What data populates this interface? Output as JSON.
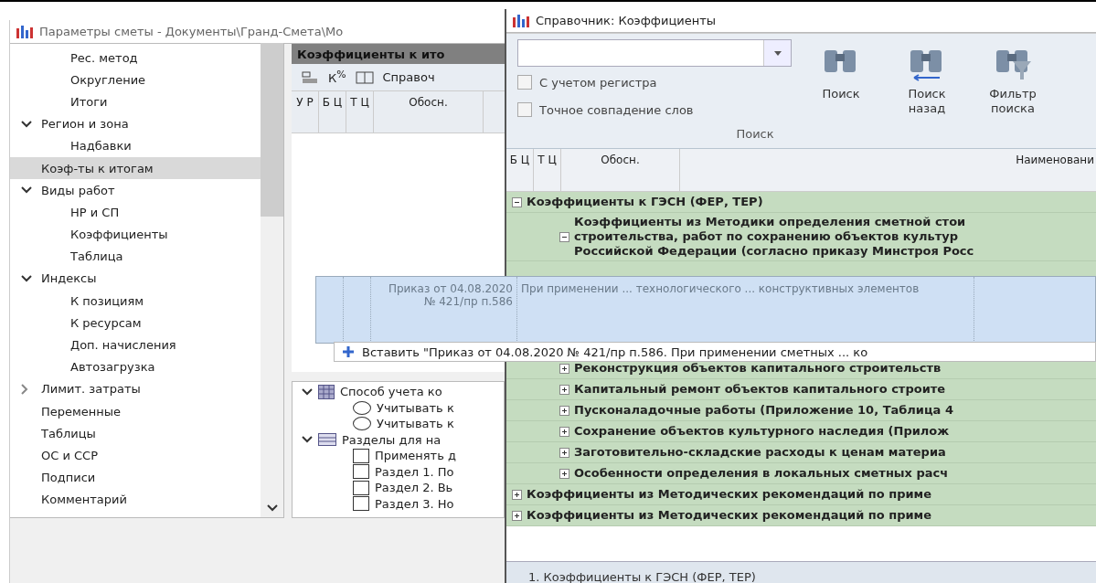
{
  "main_window": {
    "title": "Параметры сметы - Документы\\Гранд-Смета\\Мо",
    "nav": [
      {
        "children": [
          {
            "label": "Рес. метод",
            "selected": false
          },
          {
            "label": "Округление",
            "selected": false
          },
          {
            "label": "Итоги",
            "selected": false
          }
        ]
      },
      {
        "label": "Регион и зона",
        "selected": false,
        "expanded": true,
        "children": [
          {
            "label": "Надбавки",
            "selected": false
          }
        ]
      },
      {
        "label": "Коэф-ты к итогам",
        "selected": true
      },
      {
        "label": "Виды работ",
        "selected": false,
        "expanded": true,
        "children": [
          {
            "label": "НР и СП",
            "selected": false
          },
          {
            "label": "Коэффициенты",
            "selected": false
          },
          {
            "label": "Таблица",
            "selected": false
          }
        ]
      },
      {
        "label": "Индексы",
        "selected": false,
        "expanded": true,
        "children": [
          {
            "label": "К позициям",
            "selected": false
          },
          {
            "label": "К ресурсам",
            "selected": false
          },
          {
            "label": "Доп. начисления",
            "selected": false
          },
          {
            "label": "Автозагрузка",
            "selected": false
          }
        ]
      },
      {
        "label": "Лимит. затраты",
        "selected": false,
        "expanded": false
      },
      {
        "label": "Переменные",
        "selected": false
      },
      {
        "label": "Таблицы",
        "selected": false
      },
      {
        "label": "ОС и ССР",
        "selected": false
      },
      {
        "label": "Подписи",
        "selected": false
      },
      {
        "label": "Комментарий",
        "selected": false
      }
    ],
    "panel": {
      "header": "Коэффициенты к ито",
      "toolbar_label": "Справоч",
      "toolbar_k": "К",
      "toolbar_percent": "%",
      "columns": [
        "У Р",
        "Б Ц",
        "Т Ц",
        "Обосн."
      ],
      "options": [
        {
          "label": "Способ учета ко",
          "kind": "table-group",
          "expanded": true,
          "children": [
            {
              "label": "Учитывать к",
              "kind": "radio",
              "selected": false
            },
            {
              "label": "Учитывать к",
              "kind": "radio",
              "selected": false
            }
          ]
        },
        {
          "label": "Разделы для на",
          "kind": "list-group",
          "expanded": true,
          "children": [
            {
              "label": "Применять д",
              "kind": "checkbox",
              "checked": false
            },
            {
              "label": "Раздел 1. По",
              "kind": "checkbox",
              "checked": false
            },
            {
              "label": "Раздел 2. Вь",
              "kind": "checkbox",
              "checked": false
            },
            {
              "label": "Раздел 3. Но",
              "kind": "checkbox",
              "checked": false
            }
          ]
        }
      ]
    }
  },
  "dialog": {
    "title": "Справочник: Коэффициенты",
    "search": {
      "options": [
        {
          "label": "С учетом регистра",
          "checked": false
        },
        {
          "label": "Точное совпадение слов",
          "checked": false
        }
      ],
      "buttons": [
        {
          "label": "Поиск",
          "kind": "find"
        },
        {
          "label": "Поиск назад",
          "kind": "back"
        },
        {
          "label": "Фильтр поиска",
          "kind": "filter"
        }
      ],
      "group": "Поиск"
    },
    "columns": [
      "Б Ц",
      "Т Ц",
      "Обосн.",
      "Наименовани"
    ],
    "tree": [
      {
        "label": "Коэффициенты к ГЭСН (ФЕР, ТЕР)",
        "expanded": true,
        "children": [
          {
            "lines": [
              "Коэффициенты из Методики определения сметной стои",
              "строительства, работ по сохранению объектов культур",
              "Российской Федерации (согласно приказу Минстроя Росс"
            ],
            "expanded": true
          },
          {
            "label": "Реконструкция объектов капитального строительств",
            "expanded": false
          },
          {
            "label": "Капитальный ремонт объектов капитального строите",
            "expanded": false
          },
          {
            "label": "Пусконаладочные работы (Приложение 10, Таблица 4",
            "expanded": false
          },
          {
            "label": "Сохранение объектов культурного наследия (Прилож",
            "expanded": false
          },
          {
            "label": "Заготовительно-складские расходы к ценам материа",
            "expanded": false
          },
          {
            "label": "Особенности определения в локальных сметных расч",
            "expanded": false
          }
        ]
      },
      {
        "label": "Коэффициенты из Методических рекомендаций по приме",
        "expanded": false
      },
      {
        "label": "Коэффициенты из Методических рекомендаций по приме",
        "expanded": false
      }
    ],
    "status": "1. Коэффициенты к ГЭСН (ФЕР, ТЕР)"
  },
  "drag": {
    "reference": "Приказ от 04.08.2020 № 421/пр п.586",
    "name": "При применении ... технологического ... конструктивных элементов",
    "hint": "Вставить \"Приказ от 04.08.2020 № 421/пр п.586. При применении сметных ... ко"
  }
}
